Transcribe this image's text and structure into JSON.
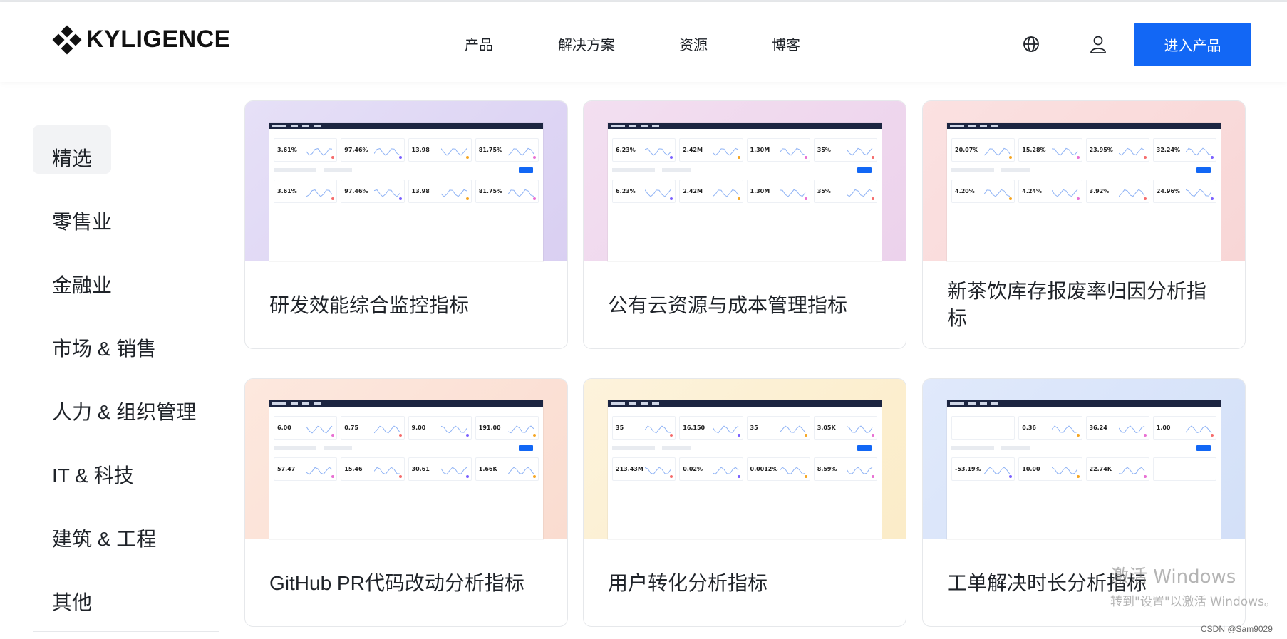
{
  "header": {
    "logo_text": "KYLIGENCE",
    "nav": [
      "产品",
      "解决方案",
      "资源",
      "博客"
    ],
    "cta_label": "进入产品",
    "icons": [
      "globe-icon",
      "user-icon"
    ],
    "accent_color": "#1267f5"
  },
  "sidebar": {
    "items": [
      "精选",
      "零售业",
      "金融业",
      "市场 & 销售",
      "人力 & 组织管理",
      "IT & 科技",
      "建筑 & 工程",
      "其他"
    ],
    "active_index": 0
  },
  "cards": [
    {
      "title": "研发效能综合监控指标",
      "gradient": [
        "#e6e0f7",
        "#d9cff2"
      ],
      "metrics": [
        "3.61%",
        "97.46%",
        "13.98",
        "81.75%"
      ],
      "metrics2": [
        "3.61%",
        "97.46%",
        "13.98",
        "81.75%"
      ]
    },
    {
      "title": "公有云资源与成本管理指标",
      "gradient": [
        "#f3dff0",
        "#ecd2ec"
      ],
      "metrics": [
        "6.23%",
        "2.42M",
        "1.30M",
        "35%"
      ],
      "metrics2": [
        "6.23%",
        "2.42M",
        "1.30M",
        "35%"
      ]
    },
    {
      "title": "新茶饮库存报废率归因分析指标",
      "gradient": [
        "#fbe1e1",
        "#f8d6d6"
      ],
      "metrics": [
        "20.07%",
        "15.28%",
        "23.95%",
        "32.24%"
      ],
      "metrics2": [
        "4.20%",
        "4.24%",
        "3.92%",
        "24.96%"
      ]
    },
    {
      "title": "GitHub PR代码改动分析指标",
      "gradient": [
        "#fde8de",
        "#fadcd0"
      ],
      "metrics": [
        "6.00",
        "0.75",
        "9.00",
        "191.00"
      ],
      "metrics2": [
        "57.47",
        "15.46",
        "30.61",
        "1.66K"
      ]
    },
    {
      "title": "用户转化分析指标",
      "gradient": [
        "#fdf3dc",
        "#fbecc8"
      ],
      "metrics": [
        "35",
        "16,150",
        "35",
        "3.05K"
      ],
      "metrics2": [
        "213.43M",
        "0.02%",
        "0.0012%",
        "8.59%"
      ]
    },
    {
      "title": "工单解决时长分析指标",
      "gradient": [
        "#e0e9fb",
        "#d3e0f8"
      ],
      "metrics": [
        "",
        "0.36",
        "36.24",
        "1.00"
      ],
      "metrics2": [
        "-53.19%",
        "10.00",
        "22.74K",
        ""
      ]
    }
  ],
  "watermark": {
    "line1": "激活 Windows",
    "line2": "转到\"设置\"以激活 Windows。"
  },
  "credit": "CSDN @Sam9029"
}
